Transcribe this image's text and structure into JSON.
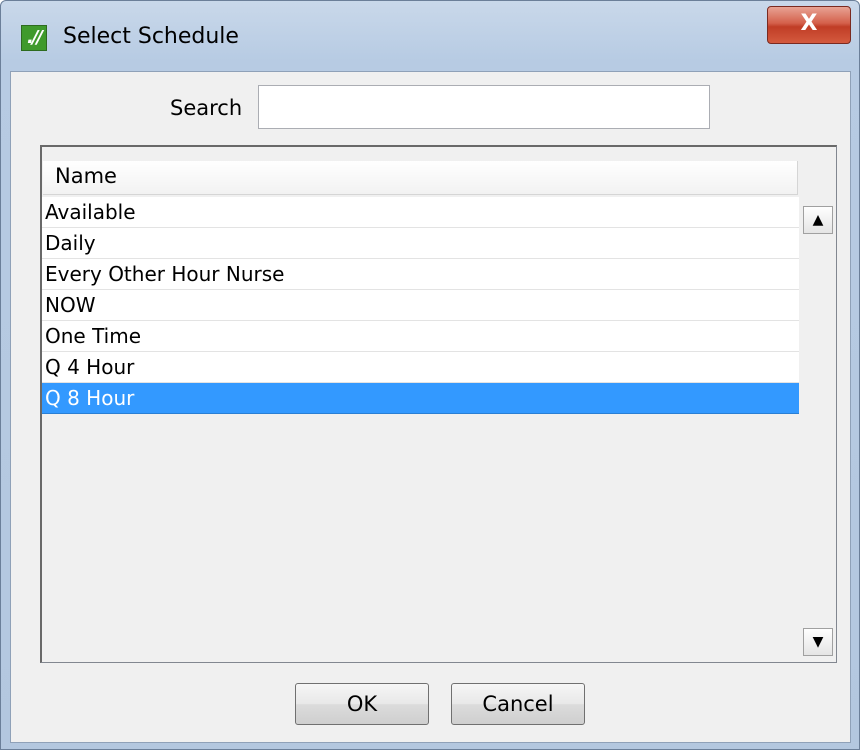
{
  "window": {
    "title": "Select Schedule",
    "app_icon_glyph": ".//",
    "close_glyph": "X",
    "icons": [
      "app-logo-icon",
      "close-icon",
      "scroll-up-arrow-icon",
      "scroll-down-arrow-icon"
    ]
  },
  "search": {
    "label": "Search",
    "value": "",
    "placeholder": ""
  },
  "list": {
    "column_header": "Name",
    "rows": [
      "Available",
      "Daily",
      "Every Other Hour Nurse",
      "NOW",
      "One Time",
      "Q 4 Hour",
      "Q 8 Hour"
    ],
    "selected": "Q 8 Hour",
    "scroll_up_glyph": "▲",
    "scroll_down_glyph": "▼"
  },
  "buttons": {
    "ok": "OK",
    "cancel": "Cancel"
  },
  "colors": {
    "selection": "#3399ff",
    "close_button": "#c8432b",
    "app_icon": "#3f9a2c"
  }
}
